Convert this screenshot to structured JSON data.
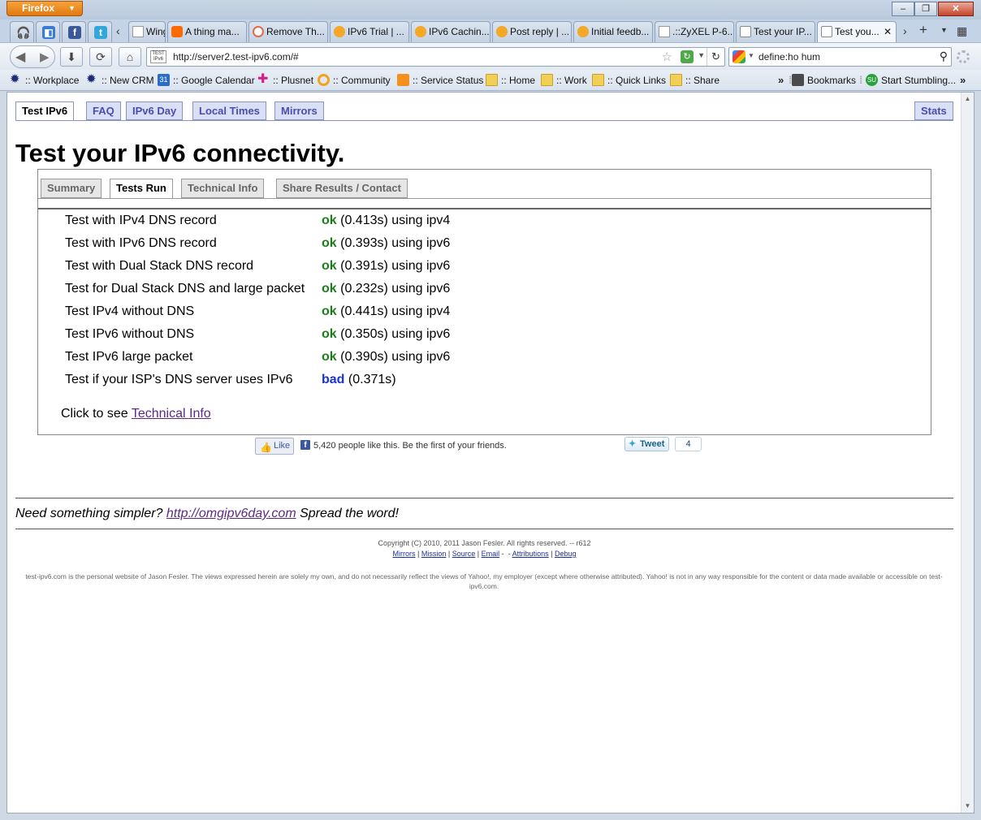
{
  "browser": {
    "app_button": "Firefox",
    "tabs": [
      {
        "label": "Wing..."
      },
      {
        "label": "A thing ma..."
      },
      {
        "label": "Remove Th..."
      },
      {
        "label": "IPv6 Trial | ..."
      },
      {
        "label": "IPv6 Cachin..."
      },
      {
        "label": "Post reply | ..."
      },
      {
        "label": "Initial feedb..."
      },
      {
        "label": ".::ZyXEL P-6..."
      },
      {
        "label": "Test your IP..."
      },
      {
        "label": "Test you..."
      }
    ],
    "url": "http://server2.test-ipv6.com/#",
    "search_query": "define:ho hum",
    "bookmarks": [
      {
        "label": ":: Workplace",
        "icon": "star-burst-icon"
      },
      {
        "label": ":: New CRM",
        "icon": "star-burst-icon"
      },
      {
        "label": ":: Google Calendar",
        "icon": "calendar-icon",
        "badge": "31"
      },
      {
        "label": ":: Plusnet",
        "icon": "plusnet-icon"
      },
      {
        "label": ":: Community",
        "icon": "speech-bubble-icon"
      },
      {
        "label": ":: Service Status",
        "icon": "rss-icon"
      },
      {
        "label": ":: Home",
        "icon": "folder-icon"
      },
      {
        "label": ":: Work",
        "icon": "folder-icon"
      },
      {
        "label": ":: Quick Links",
        "icon": "folder-icon"
      },
      {
        "label": ":: Share",
        "icon": "folder-icon"
      },
      {
        "label": "Bookmarks",
        "icon": "bookmarks-icon"
      },
      {
        "label": "Start Stumbling...",
        "icon": "stumbleupon-icon",
        "badge": "SU"
      }
    ],
    "site_icon_text": "TEST IPv6"
  },
  "page": {
    "top_tabs": [
      "Test IPv6",
      "FAQ",
      "IPv6 Day",
      "Local Times",
      "Mirrors"
    ],
    "stats_tab": "Stats",
    "title": "Test your IPv6 connectivity.",
    "sub_tabs": [
      "Summary",
      "Tests Run",
      "Technical Info",
      "Share Results / Contact"
    ],
    "tests": [
      {
        "name": "Test with IPv4 DNS record",
        "status": "ok",
        "detail": "(0.413s) using ipv4"
      },
      {
        "name": "Test with IPv6 DNS record",
        "status": "ok",
        "detail": "(0.393s) using ipv6"
      },
      {
        "name": "Test with Dual Stack DNS record",
        "status": "ok",
        "detail": "(0.391s) using ipv6"
      },
      {
        "name": "Test for Dual Stack DNS and large packet",
        "status": "ok",
        "detail": "(0.232s) using ipv6"
      },
      {
        "name": "Test IPv4 without DNS",
        "status": "ok",
        "detail": "(0.441s) using ipv4"
      },
      {
        "name": "Test IPv6 without DNS",
        "status": "ok",
        "detail": "(0.350s) using ipv6"
      },
      {
        "name": "Test IPv6 large packet",
        "status": "ok",
        "detail": "(0.390s) using ipv6"
      },
      {
        "name": "Test if your ISP's DNS server uses IPv6",
        "status": "bad",
        "detail": "(0.371s)"
      }
    ],
    "click_to_see": "Click to see",
    "technical_info_link": "Technical Info",
    "like_label": "Like",
    "like_text": "5,420 people like this. Be the first of your friends.",
    "tweet_label": "Tweet",
    "tweet_count": "4",
    "simpler_prefix": "Need something simpler?",
    "simpler_link": "http://omgipv6day.com",
    "simpler_suffix": "Spread the word!",
    "copyright": "Copyright (C) 2010, 2011 Jason Fesler. All rights reserved. -- r612",
    "footer_links": [
      "Mirrors",
      "Mission",
      "Source",
      "Email",
      "Attributions",
      "Debug"
    ],
    "disclaimer": "test-ipv6.com is the personal website of Jason Fesler. The views expressed herein are solely my own, and do not necessarily reflect the views of Yahoo!, my employer (except where otherwise attributed). Yahoo! is not in any way responsible for the content or data made available or accessible on test-ipv6.com."
  },
  "colors": {
    "ok": "#1d7d1d",
    "bad": "#1633d6",
    "link_visited": "#5b2a86",
    "tab_text": "#4a4ea8"
  }
}
